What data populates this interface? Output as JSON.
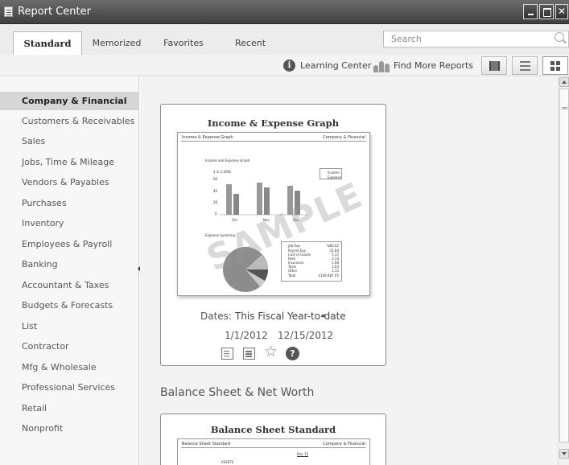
{
  "window": {
    "title": "Report Center",
    "icon": "report-icon"
  },
  "tabs": [
    {
      "label": "Standard",
      "active": true
    },
    {
      "label": "Memorized"
    },
    {
      "label": "Favorites"
    },
    {
      "label": "Recent"
    }
  ],
  "search": {
    "placeholder": "Search"
  },
  "toolbar": {
    "learning_center": "Learning Center",
    "find_more_reports": "Find More Reports",
    "views": [
      "carousel-view-icon",
      "list-view-icon",
      "grid-view-icon"
    ]
  },
  "sidebar": {
    "items": [
      {
        "label": "Company & Financial",
        "active": true
      },
      {
        "label": "Customers & Receivables"
      },
      {
        "label": "Sales"
      },
      {
        "label": "Jobs, Time & Mileage"
      },
      {
        "label": "Vendors & Payables"
      },
      {
        "label": "Purchases"
      },
      {
        "label": "Inventory"
      },
      {
        "label": "Employees & Payroll"
      },
      {
        "label": "Banking"
      },
      {
        "label": "Accountant & Taxes"
      },
      {
        "label": "Budgets & Forecasts"
      },
      {
        "label": "List"
      },
      {
        "label": "Contractor"
      },
      {
        "label": "Mfg & Wholesale"
      },
      {
        "label": "Professional Services"
      },
      {
        "label": "Retail"
      },
      {
        "label": "Nonprofit"
      }
    ]
  },
  "report_card": {
    "title": "Income & Expense Graph",
    "preview": {
      "header_left": "Income & Expense Graph",
      "header_right": "Company & Financial",
      "chart_title": "Income and Expense Graph",
      "units": "$ in 1,000s",
      "y_ticks": [
        "60",
        "40",
        "20",
        "0"
      ],
      "months": [
        "Oct",
        "Nov",
        "Dec"
      ],
      "legend": [
        "Income",
        "Expense"
      ],
      "watermark": "SAMPLE",
      "summary_title": "Expense Summary",
      "summary_items": [
        "Job Exp",
        "Payroll Exp",
        "Cost of Goods",
        "Rent",
        "Insurance",
        "Tools",
        "Other",
        "Total"
      ],
      "summary_values": [
        "%66.02",
        "31.84",
        "5.17",
        "3.14",
        "1.68",
        "1.04",
        "1.15",
        "$109,487.05"
      ]
    },
    "dates_label": "Dates:",
    "dates_value": "This Fiscal Year-to-date",
    "date_from": "1/1/2012",
    "date_to": "12/15/2012",
    "actions": [
      "run-report-icon",
      "report-info-icon",
      "favorite-star-icon",
      "help-icon"
    ]
  },
  "section": {
    "title": "Balance Sheet & Net Worth"
  },
  "report_card_2": {
    "title": "Balance Sheet Standard",
    "preview": {
      "header_left": "Balance Sheet Standard",
      "header_right": "Company & Financial",
      "column": "Dec 15",
      "first_row": "ASSETS"
    }
  },
  "colors": {
    "titlebar": "#4a4a4a",
    "sidebar_active": "#d6d6d6",
    "card_border": "#8a8a8a"
  }
}
